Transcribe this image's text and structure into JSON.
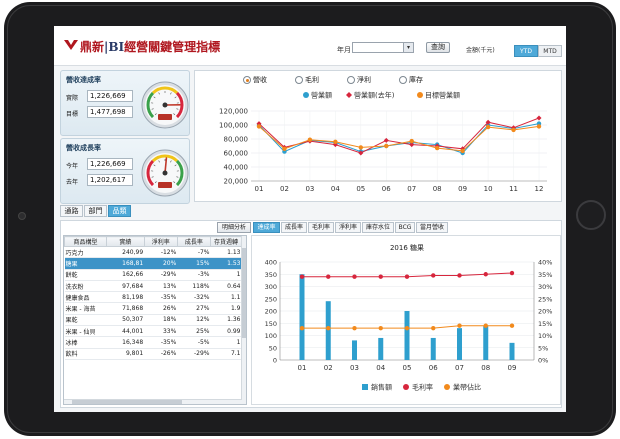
{
  "header": {
    "brand_red": "鼎新",
    "brand_sep": "|",
    "brand_bi": "BI",
    "brand_title": "經營關鍵管理指標",
    "year_month_label": "年月",
    "query_button": "查詢",
    "unit_label": "金額(千元)",
    "ytd_label": "YTD",
    "mtd_label": "MTD"
  },
  "kpi_revenue": {
    "title": "營收達成率",
    "actual_label": "實際",
    "actual_value": "1,226,669",
    "target_label": "目標",
    "target_value": "1,477,698",
    "gauge_zone_colors": [
      "#3aa14a",
      "#f0c419",
      "#d7263d"
    ],
    "needle_fraction": 0.83
  },
  "kpi_growth": {
    "title": "營收成長率",
    "this_year_label": "今年",
    "this_year_value": "1,226,669",
    "last_year_label": "去年",
    "last_year_value": "1,202,617",
    "gauge_zone_colors": [
      "#d7263d",
      "#f0c419",
      "#3aa14a"
    ],
    "needle_fraction": 0.52
  },
  "subtabs": [
    {
      "label": "通路",
      "active": false
    },
    {
      "label": "部門",
      "active": false
    },
    {
      "label": "品類",
      "active": true
    }
  ],
  "top_panel": {
    "radios": [
      {
        "label": "營收",
        "selected": true
      },
      {
        "label": "毛利",
        "selected": false
      },
      {
        "label": "淨利",
        "selected": false
      },
      {
        "label": "庫存",
        "selected": false
      }
    ]
  },
  "detail_button": "明細分析",
  "grid": {
    "columns": [
      "商品構型",
      "實績",
      "淨利率",
      "成長率",
      "存貨週轉"
    ],
    "rows": [
      [
        "巧克力",
        "240,99",
        "-12%",
        "-7%",
        "1.13"
      ],
      [
        "糖果",
        "168,81",
        "20%",
        "15%",
        "1.53"
      ],
      [
        "餅乾",
        "162,66",
        "-29%",
        "-3%",
        "1"
      ],
      [
        "洗衣粉",
        "97,684",
        "13%",
        "118%",
        "0.64"
      ],
      [
        "健康食品",
        "81,198",
        "-35%",
        "-32%",
        "1.1"
      ],
      [
        "米果 - 海苔",
        "71,868",
        "26%",
        "27%",
        "1.9"
      ],
      [
        "果乾",
        "50,307",
        "18%",
        "12%",
        "1.36"
      ],
      [
        "米果 - 仙貝",
        "44,001",
        "33%",
        "25%",
        "0.99"
      ],
      [
        "冰棒",
        "16,348",
        "-35%",
        "-5%",
        "1"
      ],
      [
        "飲料",
        "9,801",
        "-26%",
        "-29%",
        "7.1"
      ]
    ],
    "selected_row": 1
  },
  "chart_tabs": [
    {
      "label": "達成率",
      "active": true
    },
    {
      "label": "成長率",
      "active": false
    },
    {
      "label": "毛利率",
      "active": false
    },
    {
      "label": "淨利率",
      "active": false
    },
    {
      "label": "庫存水位",
      "active": false
    },
    {
      "label": "BCG",
      "active": false
    },
    {
      "label": "當月營收",
      "active": false
    }
  ],
  "colors": {
    "accent_blue": "#4ea9d8",
    "revenue": "#2e9fce",
    "revenue_last_year": "#d7263d",
    "target_revenue": "#f28a1c",
    "sales_bar": "#2e9fce",
    "margin_line": "#d7263d",
    "share_line": "#f28a1c"
  },
  "chart_data": [
    {
      "type": "line",
      "title": "",
      "x": [
        "01",
        "02",
        "03",
        "04",
        "05",
        "06",
        "07",
        "08",
        "09",
        "10",
        "11",
        "12"
      ],
      "series": [
        {
          "name": "營業額",
          "values": [
            100000,
            62000,
            78000,
            75000,
            62000,
            70000,
            75000,
            72000,
            60000,
            100000,
            95000,
            102000
          ]
        },
        {
          "name": "營業額(去年)",
          "values": [
            102000,
            68000,
            77000,
            72000,
            60000,
            78000,
            72000,
            70000,
            66000,
            104000,
            96000,
            110000
          ]
        },
        {
          "name": "目標營業額",
          "values": [
            98000,
            66000,
            79000,
            76000,
            68000,
            70000,
            77000,
            67000,
            63000,
            97000,
            93000,
            98000
          ]
        }
      ],
      "ylim": [
        20000,
        120000
      ],
      "yticks": [
        20000,
        40000,
        60000,
        80000,
        100000,
        120000
      ],
      "legend": "top",
      "grid": true
    },
    {
      "type": "bar",
      "title": "2016 糖果",
      "categories": [
        "01",
        "02",
        "03",
        "04",
        "05",
        "06",
        "07",
        "08",
        "09"
      ],
      "series": [
        {
          "name": "銷售額",
          "axis": "left",
          "values": [
            350,
            240,
            80,
            90,
            200,
            90,
            130,
            140,
            70
          ]
        },
        {
          "name": "毛利率",
          "axis": "right",
          "type": "line",
          "values": [
            0.34,
            0.34,
            0.34,
            0.34,
            0.34,
            0.345,
            0.345,
            0.35,
            0.355
          ]
        },
        {
          "name": "業帶佔比",
          "axis": "right",
          "type": "line",
          "values": [
            0.13,
            0.13,
            0.13,
            0.13,
            0.13,
            0.13,
            0.14,
            0.14,
            0.14
          ]
        }
      ],
      "ylim_left": [
        0,
        400
      ],
      "yticks_left": [
        0,
        50,
        100,
        150,
        200,
        250,
        300,
        350,
        400
      ],
      "ylim_right": [
        0,
        0.4
      ],
      "yticks_right": [
        "0%",
        "5%",
        "10%",
        "15%",
        "20%",
        "25%",
        "30%",
        "35%",
        "40%"
      ],
      "legend": "bottom",
      "grid": true
    }
  ]
}
